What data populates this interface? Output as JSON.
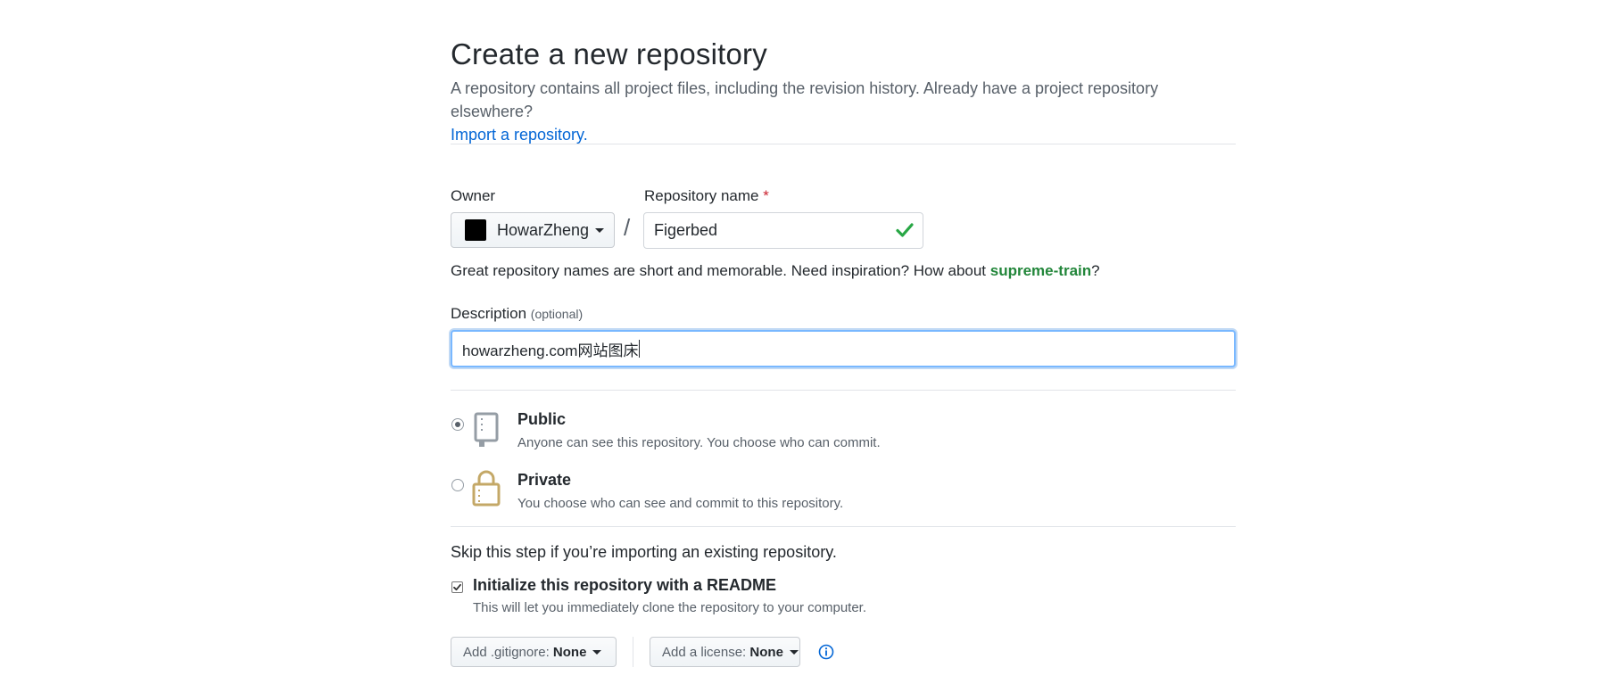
{
  "header": {
    "title": "Create a new repository",
    "subtitle": "A repository contains all project files, including the revision history. Already have a project repository elsewhere?",
    "import_link": "Import a repository."
  },
  "form": {
    "owner_label": "Owner",
    "owner_value": "HowarZheng",
    "separator": "/",
    "repo_name_label": "Repository name",
    "required_marker": "*",
    "repo_name_value": "Figerbed",
    "hint_prefix": "Great repository names are short and memorable. Need inspiration? How about",
    "hint_suggestion": "supreme-train",
    "hint_suffix": "?",
    "description_label": "Description",
    "description_optional": "(optional)",
    "description_value": "howarzheng.com网站图床"
  },
  "visibility": {
    "selected": "public",
    "options": [
      {
        "title": "Public",
        "description": "Anyone can see this repository. You choose who can commit."
      },
      {
        "title": "Private",
        "description": "You choose who can see and commit to this repository."
      }
    ]
  },
  "init": {
    "skip_text": "Skip this step if you’re importing an existing repository.",
    "readme_label": "Initialize this repository with a README",
    "readme_desc": "This will let you immediately clone the repository to your computer.",
    "readme_checked": true,
    "gitignore_prefix": "Add .gitignore:",
    "gitignore_value": "None",
    "license_prefix": "Add a license:",
    "license_value": "None"
  },
  "colors": {
    "link": "#0366d6",
    "success": "#28a745",
    "required": "#cb2431",
    "focus_border": "#79b8ff"
  }
}
